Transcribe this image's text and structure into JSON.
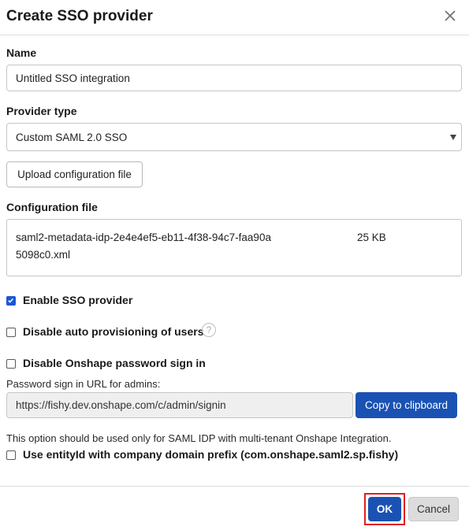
{
  "dialog": {
    "title": "Create SSO provider",
    "close_icon": "close-icon"
  },
  "name": {
    "label": "Name",
    "value": "Untitled SSO integration"
  },
  "provider_type": {
    "label": "Provider type",
    "selected": "Custom SAML 2.0 SSO"
  },
  "upload_button": "Upload configuration file",
  "config_file": {
    "label": "Configuration file",
    "filename": "saml2-metadata-idp-2e4e4ef5-eb11-4f38-94c7-faa90a5098c0.xml",
    "size": "25 KB"
  },
  "options": {
    "enable_sso": {
      "label": "Enable SSO provider",
      "checked": true
    },
    "disable_auto_provisioning": {
      "label": "Disable auto provisioning of users",
      "checked": false,
      "help_icon": "?"
    },
    "disable_password_signin": {
      "label": "Disable Onshape password sign in",
      "checked": false
    }
  },
  "password_signin": {
    "label": "Password sign in URL for admins:",
    "url": "https://fishy.dev.onshape.com/c/admin/signin",
    "copy_button": "Copy to clipboard"
  },
  "saml_note": "This option should be used only for SAML IDP with multi-tenant Onshape Integration.",
  "entity_id": {
    "label": "Use entityId with company domain prefix (com.onshape.saml2.sp.fishy)",
    "checked": false
  },
  "footer": {
    "ok": "OK",
    "cancel": "Cancel"
  },
  "colors": {
    "primary": "#1a52b4",
    "checkbox": "#1a57d6",
    "highlight": "#e02020"
  }
}
